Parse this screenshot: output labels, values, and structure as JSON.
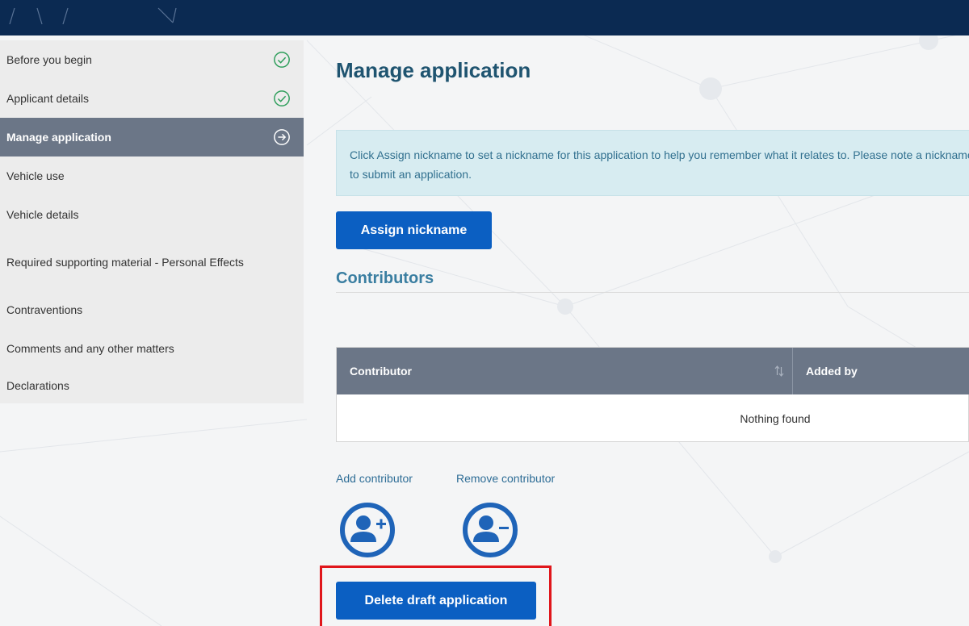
{
  "sidebar": {
    "items": [
      {
        "label": "Before you begin",
        "status": "complete"
      },
      {
        "label": "Applicant details",
        "status": "complete"
      },
      {
        "label": "Manage application",
        "status": "current"
      },
      {
        "label": "Vehicle use",
        "status": ""
      },
      {
        "label": "Vehicle details",
        "status": ""
      },
      {
        "label": "Required supporting material - Personal Effects",
        "status": ""
      },
      {
        "label": "Contraventions",
        "status": ""
      },
      {
        "label": "Comments and any other matters",
        "status": ""
      },
      {
        "label": "Declarations",
        "status": ""
      }
    ]
  },
  "main": {
    "title": "Manage application",
    "info_line1": "Click Assign nickname to set a nickname for this application to help you remember what it relates to. Please note a nickname is not required",
    "info_line2": "to submit an application.",
    "assign_nickname_label": "Assign nickname",
    "contributors_heading": "Contributors",
    "table": {
      "columns": [
        "Contributor",
        "Added by"
      ],
      "empty_text": "Nothing found"
    },
    "add_contributor_label": "Add contributor",
    "remove_contributor_label": "Remove contributor",
    "delete_draft_label": "Delete draft application"
  },
  "icons": {
    "complete": "check-circle-icon",
    "current": "arrow-circle-icon",
    "sort": "sort-icon",
    "add_user": "add-user-icon",
    "remove_user": "remove-user-icon"
  },
  "colors": {
    "header": "#0b2a52",
    "primary_button": "#0b5fc2",
    "active_nav": "#6b7687",
    "check_green": "#2e9e5b",
    "info_bg": "#d7ecf1",
    "highlight": "#e0161b"
  }
}
